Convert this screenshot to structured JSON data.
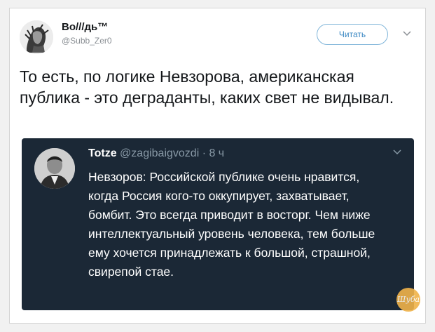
{
  "tweet": {
    "author_name": "Во///дь™",
    "author_handle": "@Subb_Zer0",
    "follow_label": "Читать",
    "text": "То есть, по логике Невзорова, американская публика - это деграданты, каких свет не видывал."
  },
  "quoted_tweet": {
    "author_name": "Totze",
    "author_meta": "@zagibaigvozdi · 8 ч",
    "text": "Невзоров: Российской публике очень нравится, когда Россия кого-то оккупирует, захватывает, бомбит. Это всегда приводит в восторг. Чем ниже интеллектуальный уровень человека, тем больше ему хочется принадлежать к большой, страшной, свирепой стае."
  },
  "watermark": {
    "text": "Шуба"
  },
  "icons": [
    "avatar-illustration",
    "chevron-down-icon",
    "avatar-photo",
    "watermark-logo"
  ],
  "colors": {
    "accent": "#3b88c3",
    "quote_background": "#1b2836",
    "muted_text": "#8899a6"
  }
}
